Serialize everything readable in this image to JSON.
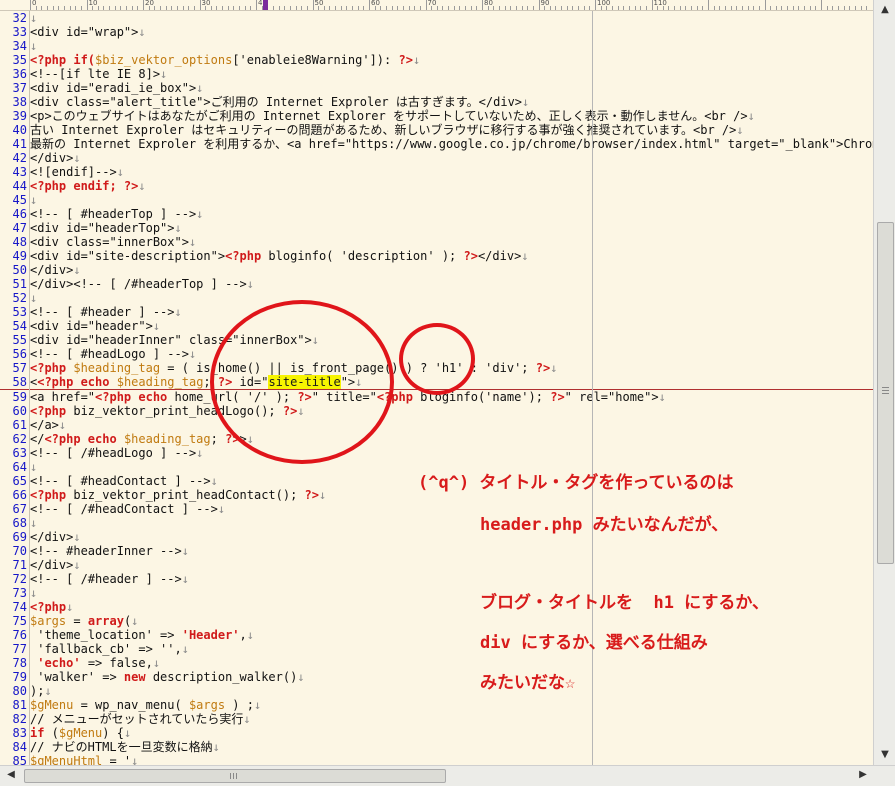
{
  "ruler": {
    "labels": [
      "0",
      "10",
      "20",
      "30",
      "40",
      "50",
      "60",
      "70",
      "80",
      "90",
      "100",
      "110"
    ]
  },
  "editor": {
    "lines": [
      {
        "n": "32",
        "tokens": [
          {
            "t": "",
            "c": "default"
          }
        ]
      },
      {
        "n": "33",
        "tokens": [
          {
            "t": "<div id=\"wrap\">",
            "c": "default"
          }
        ]
      },
      {
        "n": "34",
        "tokens": [
          {
            "t": "",
            "c": "default"
          }
        ]
      },
      {
        "n": "35",
        "tokens": [
          {
            "t": "<?php if(",
            "c": "php"
          },
          {
            "t": "$biz_vektor_options",
            "c": "var"
          },
          {
            "t": "['enableie8Warning']): ",
            "c": "default"
          },
          {
            "t": "?>",
            "c": "php"
          }
        ]
      },
      {
        "n": "36",
        "tokens": [
          {
            "t": "<!--[if lte IE 8]>",
            "c": "default"
          }
        ]
      },
      {
        "n": "37",
        "tokens": [
          {
            "t": "<div id=\"eradi_ie_box\">",
            "c": "default"
          }
        ]
      },
      {
        "n": "38",
        "tokens": [
          {
            "t": "<div class=\"alert_title\">ご利用の Internet Exproler は古すぎます。</div>",
            "c": "default"
          }
        ]
      },
      {
        "n": "39",
        "tokens": [
          {
            "t": "<p>このウェブサイトはあなたがご利用の Internet Explorer をサポートしていないため、正しく表示・動作しません。<br />",
            "c": "default"
          }
        ]
      },
      {
        "n": "40",
        "tokens": [
          {
            "t": "古い Internet Exproler はセキュリティーの問題があるため、新しいブラウザに移行する事が強く推奨されています。<br />",
            "c": "default"
          }
        ]
      },
      {
        "n": "41",
        "tokens": [
          {
            "t": "最新の Internet Exproler を利用するか、<a href=\"https://www.google.co.jp/chrome/browser/index.html\" target=\"_blank\">Chrom",
            "c": "default"
          }
        ]
      },
      {
        "n": "42",
        "tokens": [
          {
            "t": "</div>",
            "c": "default"
          }
        ]
      },
      {
        "n": "43",
        "tokens": [
          {
            "t": "<![endif]-->",
            "c": "default"
          }
        ]
      },
      {
        "n": "44",
        "tokens": [
          {
            "t": "<?php endif; ?>",
            "c": "php"
          }
        ]
      },
      {
        "n": "45",
        "tokens": [
          {
            "t": "",
            "c": "default"
          }
        ]
      },
      {
        "n": "46",
        "tokens": [
          {
            "t": "<!-- [ #headerTop ] -->",
            "c": "default"
          }
        ]
      },
      {
        "n": "47",
        "tokens": [
          {
            "t": "<div id=\"headerTop\">",
            "c": "default"
          }
        ]
      },
      {
        "n": "48",
        "tokens": [
          {
            "t": "<div class=\"innerBox\">",
            "c": "default"
          }
        ]
      },
      {
        "n": "49",
        "tokens": [
          {
            "t": "<div id=\"site-description\">",
            "c": "default"
          },
          {
            "t": "<?php",
            "c": "php"
          },
          {
            "t": " bloginfo( 'description' ); ",
            "c": "default"
          },
          {
            "t": "?>",
            "c": "php"
          },
          {
            "t": "</div>",
            "c": "default"
          }
        ]
      },
      {
        "n": "50",
        "tokens": [
          {
            "t": "</div>",
            "c": "default"
          }
        ]
      },
      {
        "n": "51",
        "tokens": [
          {
            "t": "</div><!-- [ /#headerTop ] -->",
            "c": "default"
          }
        ]
      },
      {
        "n": "52",
        "tokens": [
          {
            "t": "",
            "c": "default"
          }
        ]
      },
      {
        "n": "53",
        "tokens": [
          {
            "t": "<!-- [ #header ] -->",
            "c": "default"
          }
        ]
      },
      {
        "n": "54",
        "tokens": [
          {
            "t": "<div id=\"header\">",
            "c": "default"
          }
        ]
      },
      {
        "n": "55",
        "tokens": [
          {
            "t": "<div id=\"headerInner\" class=\"innerBox\">",
            "c": "default"
          }
        ]
      },
      {
        "n": "56",
        "tokens": [
          {
            "t": "<!-- [ #headLogo ] -->",
            "c": "default"
          }
        ]
      },
      {
        "n": "57",
        "tokens": [
          {
            "t": "<?php ",
            "c": "php"
          },
          {
            "t": "$heading_tag",
            "c": "var"
          },
          {
            "t": " = ( is_home() || is_front_page() ) ? 'h1' : 'div'; ",
            "c": "default"
          },
          {
            "t": "?>",
            "c": "php"
          }
        ]
      },
      {
        "n": "58",
        "cur": true,
        "tokens": [
          {
            "t": "<",
            "c": "default"
          },
          {
            "t": "<?php echo ",
            "c": "php"
          },
          {
            "t": "$heading_tag",
            "c": "var"
          },
          {
            "t": "; ",
            "c": "default"
          },
          {
            "t": "?>",
            "c": "php"
          },
          {
            "t": " id=\"",
            "c": "default"
          },
          {
            "t": "site-title",
            "c": "hl"
          },
          {
            "t": "\">",
            "c": "default"
          }
        ]
      },
      {
        "n": "59",
        "tokens": [
          {
            "t": "<a href=\"",
            "c": "default"
          },
          {
            "t": "<?php echo",
            "c": "php"
          },
          {
            "t": " home_url( '/' ); ",
            "c": "default"
          },
          {
            "t": "?>",
            "c": "php"
          },
          {
            "t": "\" title=\"",
            "c": "default"
          },
          {
            "t": "<?php",
            "c": "php"
          },
          {
            "t": " bloginfo('name'); ",
            "c": "default"
          },
          {
            "t": "?>",
            "c": "php"
          },
          {
            "t": "\" rel=\"home\">",
            "c": "default"
          }
        ]
      },
      {
        "n": "60",
        "tokens": [
          {
            "t": "<?php",
            "c": "php"
          },
          {
            "t": " biz_vektor_print_headLogo(); ",
            "c": "default"
          },
          {
            "t": "?>",
            "c": "php"
          }
        ]
      },
      {
        "n": "61",
        "tokens": [
          {
            "t": "</a>",
            "c": "default"
          }
        ]
      },
      {
        "n": "62",
        "tokens": [
          {
            "t": "</",
            "c": "default"
          },
          {
            "t": "<?php echo ",
            "c": "php"
          },
          {
            "t": "$heading_tag",
            "c": "var"
          },
          {
            "t": "; ",
            "c": "default"
          },
          {
            "t": "?>",
            "c": "php"
          },
          {
            "t": ">",
            "c": "default"
          }
        ]
      },
      {
        "n": "63",
        "tokens": [
          {
            "t": "<!-- [ /#headLogo ] -->",
            "c": "default"
          }
        ]
      },
      {
        "n": "64",
        "tokens": [
          {
            "t": "",
            "c": "default"
          }
        ]
      },
      {
        "n": "65",
        "tokens": [
          {
            "t": "<!-- [ #headContact ] -->",
            "c": "default"
          }
        ]
      },
      {
        "n": "66",
        "tokens": [
          {
            "t": "<?php",
            "c": "php"
          },
          {
            "t": " biz_vektor_print_headContact(); ",
            "c": "default"
          },
          {
            "t": "?>",
            "c": "php"
          }
        ]
      },
      {
        "n": "67",
        "tokens": [
          {
            "t": "<!-- [ /#headContact ] -->",
            "c": "default"
          }
        ]
      },
      {
        "n": "68",
        "tokens": [
          {
            "t": "",
            "c": "default"
          }
        ]
      },
      {
        "n": "69",
        "tokens": [
          {
            "t": "</div>",
            "c": "default"
          }
        ]
      },
      {
        "n": "70",
        "tokens": [
          {
            "t": "<!-- #headerInner -->",
            "c": "default"
          }
        ]
      },
      {
        "n": "71",
        "tokens": [
          {
            "t": "</div>",
            "c": "default"
          }
        ]
      },
      {
        "n": "72",
        "tokens": [
          {
            "t": "<!-- [ /#header ] -->",
            "c": "default"
          }
        ]
      },
      {
        "n": "73",
        "tokens": [
          {
            "t": "",
            "c": "default"
          }
        ]
      },
      {
        "n": "74",
        "tokens": [
          {
            "t": "<?php",
            "c": "php"
          }
        ]
      },
      {
        "n": "75",
        "tokens": [
          {
            "t": "$args",
            "c": "var"
          },
          {
            "t": " = ",
            "c": "default"
          },
          {
            "t": "array",
            "c": "php"
          },
          {
            "t": "(",
            "c": "default"
          }
        ]
      },
      {
        "n": "76",
        "tokens": [
          {
            "t": " 'theme_location' => ",
            "c": "default"
          },
          {
            "t": "'Header'",
            "c": "php"
          },
          {
            "t": ",",
            "c": "default"
          }
        ]
      },
      {
        "n": "77",
        "tokens": [
          {
            "t": " 'fallback_cb' => '',",
            "c": "default"
          }
        ]
      },
      {
        "n": "78",
        "tokens": [
          {
            "t": " ",
            "c": "default"
          },
          {
            "t": "'echo'",
            "c": "php"
          },
          {
            "t": " => false,",
            "c": "default"
          }
        ]
      },
      {
        "n": "79",
        "tokens": [
          {
            "t": " 'walker' => ",
            "c": "default"
          },
          {
            "t": "new",
            "c": "php"
          },
          {
            "t": " description_walker()",
            "c": "default"
          }
        ]
      },
      {
        "n": "80",
        "tokens": [
          {
            "t": ");",
            "c": "default"
          }
        ]
      },
      {
        "n": "81",
        "tokens": [
          {
            "t": "$gMenu",
            "c": "var"
          },
          {
            "t": " = wp_nav_menu( ",
            "c": "default"
          },
          {
            "t": "$args",
            "c": "var"
          },
          {
            "t": " ) ;",
            "c": "default"
          }
        ]
      },
      {
        "n": "82",
        "tokens": [
          {
            "t": "// メニューがセットされていたら実行",
            "c": "default"
          }
        ]
      },
      {
        "n": "83",
        "tokens": [
          {
            "t": "if",
            "c": "php"
          },
          {
            "t": " (",
            "c": "default"
          },
          {
            "t": "$gMenu",
            "c": "var"
          },
          {
            "t": ") {",
            "c": "default"
          }
        ]
      },
      {
        "n": "84",
        "tokens": [
          {
            "t": "// ナビのHTMLを一旦変数に格納",
            "c": "default"
          }
        ]
      },
      {
        "n": "85",
        "tokens": [
          {
            "t": "$gMenuHtml",
            "c": "var"
          },
          {
            "t": " = '",
            "c": "default"
          }
        ]
      }
    ]
  },
  "annotation": {
    "lines": [
      "(^q^) タイトル・タグを作っているのは",
      "header.php みたいなんだが、",
      "ブログ・タイトルを  h1 にするか、",
      "div にするか、選べる仕組み",
      "みたいだな☆"
    ]
  },
  "colors": {
    "background": "#fcf6e4",
    "line_number": "#1616c8",
    "php_keyword": "#d01a1a",
    "variable": "#c07a10",
    "highlight": "#f7f400",
    "annotation": "#d81b1b"
  },
  "icons": {
    "scroll_left": "arrow-left",
    "scroll_right": "arrow-right",
    "scroll_up": "arrow-up",
    "scroll_down": "arrow-down"
  }
}
